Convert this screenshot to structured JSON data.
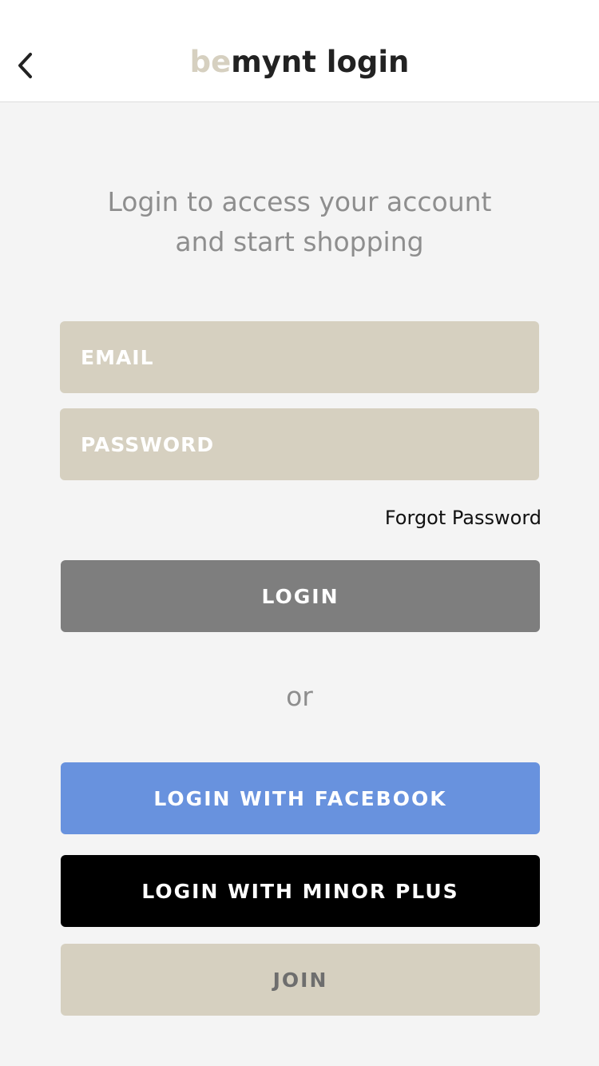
{
  "header": {
    "back_icon": "chevron-left-icon",
    "title_prefix": "be",
    "title_rest": "mynt login",
    "brand_color": "#d6d0c0"
  },
  "intro": {
    "line1": "Login to access your account",
    "line2": "and start shopping"
  },
  "form": {
    "email_placeholder": "EMAIL",
    "password_placeholder": "PASSWORD",
    "forgot_label": "Forgot Password",
    "login_label": "LOGIN"
  },
  "divider": {
    "or_label": "or"
  },
  "social": {
    "facebook_label": "LOGIN WITH FACEBOOK",
    "facebook_color": "#6892de",
    "minor_label": "LOGIN WITH MINOR PLUS",
    "minor_color": "#000000"
  },
  "join": {
    "label": "JOIN"
  }
}
